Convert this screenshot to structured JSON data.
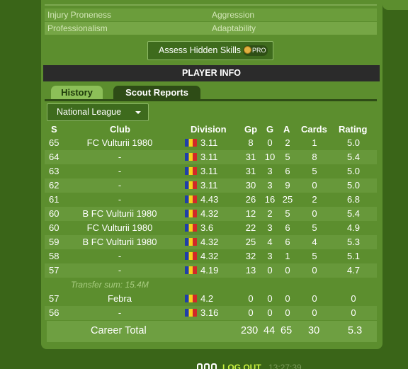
{
  "hidden_skills": {
    "rows": [
      {
        "left": "Injury Proneness",
        "right": "Aggression"
      },
      {
        "left": "Professionalism",
        "right": "Adaptability"
      }
    ],
    "assess_button": "Assess Hidden Skills",
    "pro_badge": "PRO"
  },
  "section": {
    "title": "PLAYER INFO"
  },
  "tabs": {
    "history": "History",
    "scout_reports": "Scout Reports"
  },
  "league_select": {
    "value": "National League"
  },
  "table": {
    "headers": {
      "s": "S",
      "club": "Club",
      "division": "Division",
      "gp": "Gp",
      "g": "G",
      "a": "A",
      "cards": "Cards",
      "rating": "Rating"
    },
    "rows": [
      {
        "s": "65",
        "club": "FC Vulturii 1980",
        "division": "3.11",
        "gp": "8",
        "g": "0",
        "a": "2",
        "cards": "1",
        "rating": "5.0"
      },
      {
        "s": "64",
        "club": "-",
        "division": "3.11",
        "gp": "31",
        "g": "10",
        "a": "5",
        "cards": "8",
        "rating": "5.4"
      },
      {
        "s": "63",
        "club": "-",
        "division": "3.11",
        "gp": "31",
        "g": "3",
        "a": "6",
        "cards": "5",
        "rating": "5.0"
      },
      {
        "s": "62",
        "club": "-",
        "division": "3.11",
        "gp": "30",
        "g": "3",
        "a": "9",
        "cards": "0",
        "rating": "5.0"
      },
      {
        "s": "61",
        "club": "-",
        "division": "4.43",
        "gp": "26",
        "g": "16",
        "a": "25",
        "cards": "2",
        "rating": "6.8"
      },
      {
        "s": "60",
        "club": "B FC Vulturii 1980",
        "division": "4.32",
        "gp": "12",
        "g": "2",
        "a": "5",
        "cards": "0",
        "rating": "5.4"
      },
      {
        "s": "60",
        "club": "FC Vulturii 1980",
        "division": "3.6",
        "gp": "22",
        "g": "3",
        "a": "6",
        "cards": "5",
        "rating": "4.9"
      },
      {
        "s": "59",
        "club": "B FC Vulturii 1980",
        "division": "4.32",
        "gp": "25",
        "g": "4",
        "a": "6",
        "cards": "4",
        "rating": "5.3"
      },
      {
        "s": "58",
        "club": "-",
        "division": "4.32",
        "gp": "32",
        "g": "3",
        "a": "1",
        "cards": "5",
        "rating": "5.1"
      },
      {
        "s": "57",
        "club": "-",
        "division": "4.19",
        "gp": "13",
        "g": "0",
        "a": "0",
        "cards": "0",
        "rating": "4.7"
      }
    ],
    "transfer_note": "Transfer sum: 15.4M",
    "rows_after": [
      {
        "s": "57",
        "club": "Febra",
        "division": "4.2",
        "gp": "0",
        "g": "0",
        "a": "0",
        "cards": "0",
        "rating": "0"
      },
      {
        "s": "56",
        "club": "-",
        "division": "3.16",
        "gp": "0",
        "g": "0",
        "a": "0",
        "cards": "0",
        "rating": "0"
      }
    ],
    "career_total": {
      "label": "Career Total",
      "gp": "230",
      "g": "44",
      "a": "65",
      "cards": "30",
      "rating": "5.3"
    }
  },
  "footer": {
    "logout": "LOG OUT",
    "clock": "13:27:39"
  },
  "colors": {
    "background": "#3a6518",
    "panel": "#5c8e2e",
    "header_bar": "#2b2b2b",
    "active_tab": "#8cbf58",
    "logout": "#c8f040"
  },
  "icons": {
    "flag": "romania-flag-icon",
    "pro": "pro-coin-icon",
    "dropdown": "chevron-down-icon"
  }
}
